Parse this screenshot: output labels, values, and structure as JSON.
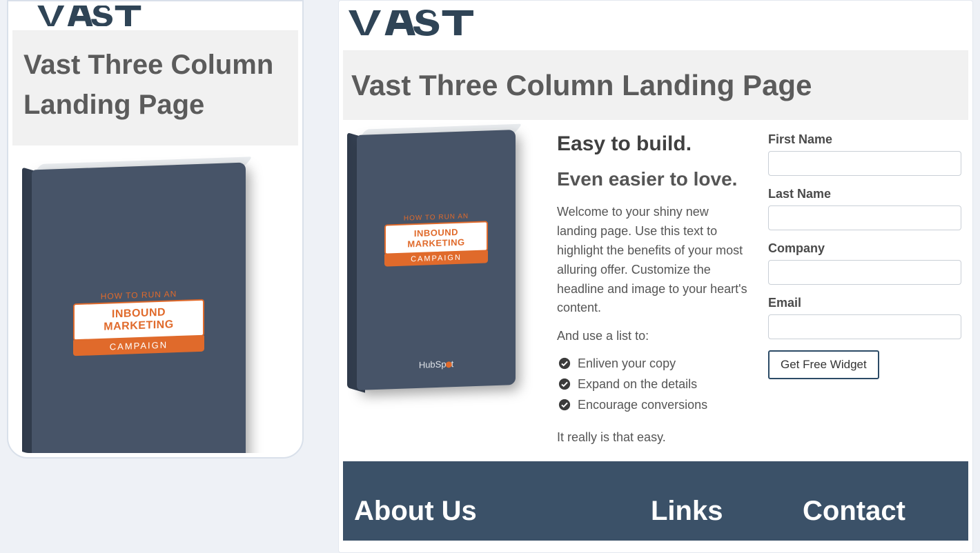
{
  "brand": {
    "name": "VAST"
  },
  "mobile": {
    "title": "Vast Three Column Landing Page",
    "book": {
      "ribbon_top": "HOW TO RUN AN",
      "ribbon_mid": "INBOUND MARKETING",
      "ribbon_bot": "CAMPAIGN"
    }
  },
  "desktop": {
    "title": "Vast Three Column Landing Page",
    "heading1": "Easy to build.",
    "heading2": "Even easier to love.",
    "welcome": "Welcome to your shiny new landing page. Use this text to highlight the benefits of your most alluring offer. Customize the headline and image to your heart's content.",
    "list_intro": "And use a list to:",
    "list_items": [
      "Enliven your copy",
      "Expand on the details",
      "Encourage conversions"
    ],
    "easy": "It really is that easy.",
    "book": {
      "ribbon_top": "HOW TO RUN AN",
      "ribbon_mid": "INBOUND MARKETING",
      "ribbon_bot": "CAMPAIGN",
      "hub_prefix": "HubSp",
      "hub_suffix": "t"
    },
    "form": {
      "first_name": "First Name",
      "last_name": "Last Name",
      "company": "Company",
      "email": "Email",
      "submit": "Get Free Widget"
    },
    "footer": {
      "about": "About Us",
      "links": "Links",
      "contact": "Contact"
    }
  }
}
